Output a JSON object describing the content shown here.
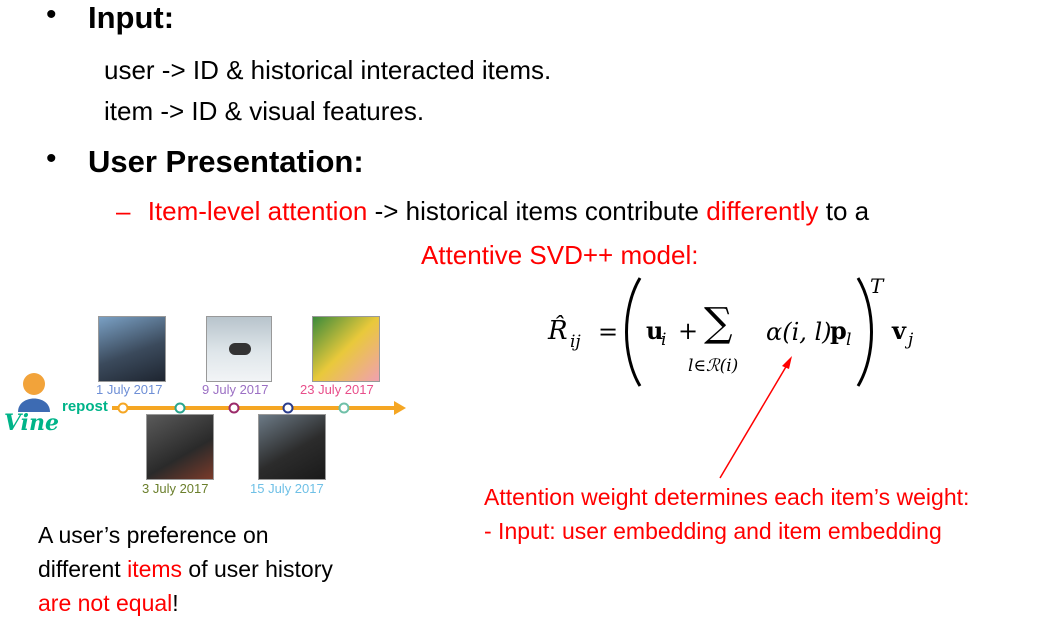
{
  "slide": {
    "input": {
      "heading": "Input:",
      "lines": [
        "user -> ID & historical interacted items.",
        "item -> ID & visual features."
      ]
    },
    "user_presentation": {
      "heading": "User Presentation:",
      "sub_dash": "–",
      "sub_red_1": "Item-level attention",
      "sub_black_1": " -> historical items contribute ",
      "sub_red_2": "differently",
      "sub_black_2": " to a",
      "model_line": "Attentive SVD++ model:"
    },
    "formula": {
      "lhs": "R̂",
      "lhs_sub": "ij",
      "eq": "=",
      "u": "u",
      "u_sub": "i",
      "plus": "+",
      "sum": "∑",
      "sum_sub": "l∈ℛ(i)",
      "alpha": "α(i, l)",
      "p": "p",
      "p_sub": "l",
      "sup": "T",
      "v": "v",
      "v_sub": "j"
    },
    "annotation": {
      "line1": "Attention weight determines each item’s weight:",
      "line2": "- Input: user embedding and item embedding"
    },
    "timeline": {
      "logo_text": "Vine",
      "repost_label": "repost",
      "dates_top": [
        "1 July 2017",
        "9 July 2017",
        "23 July 2017"
      ],
      "dates_bottom": [
        "3 July 2017",
        "15 July 2017"
      ],
      "date_colors": [
        "#6e8fd6",
        "#9b6fc4",
        "#e84e8a",
        "#6b7f2c",
        "#6fc0e6"
      ]
    },
    "caption": {
      "line1": "A user’s preference on",
      "line2_black": "different ",
      "line2_red": "items",
      "line2_black2": " of user history",
      "line3_red": "are not equal",
      "line3_black": "!"
    },
    "colors": {
      "accent_red": "#ff0000",
      "timeline_orange": "#f5a623",
      "vine_green": "#00b489"
    }
  }
}
